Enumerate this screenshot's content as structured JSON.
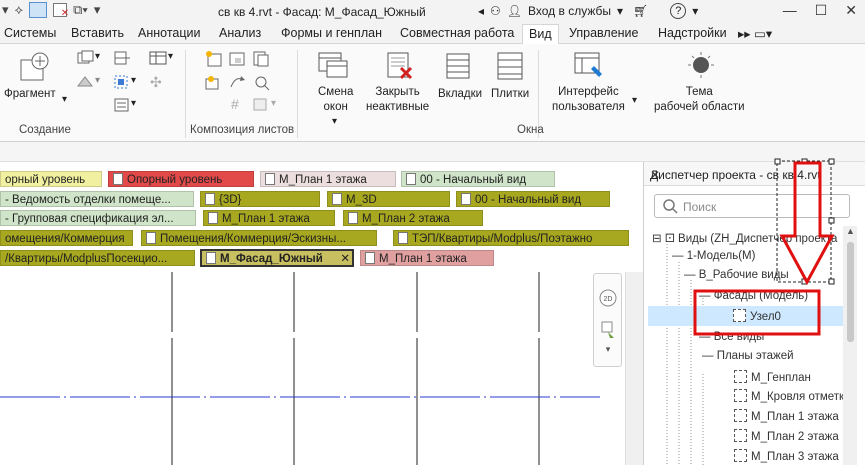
{
  "titlebar": {
    "title": "св кв 4.rvt - Фасад: М_Фасад_Южный",
    "signin": "Вход в службы",
    "signin_caret": "▾",
    "help": "?",
    "min": "—",
    "max": "☐",
    "close": "✕"
  },
  "tabs": [
    "Системы",
    "Вставить",
    "Аннотации",
    "Анализ",
    "Формы и генплан",
    "Совместная работа",
    "Вид",
    "Управление",
    "Надстройки"
  ],
  "ribbon": {
    "fragment": "Фрагмент",
    "create_panel": "Создание",
    "sheet_panel": "Композиция листов",
    "switch_windows": "Смена\nокон",
    "close_inactive": "Закрыть\nнеактивные",
    "tab_views": "Вкладки",
    "tiles": "Плитки",
    "ui": "Интерфейс\nпользователя",
    "theme": "Тема\nрабочей области",
    "windows_panel": "Окна"
  },
  "viewtabs": [
    {
      "label": "орный уровень",
      "color": "#f0f0a0"
    },
    {
      "label": "Опорный уровень",
      "color": "#e24a4a"
    },
    {
      "label": "М_План 1 этажа",
      "color": "#e8d8d8"
    },
    {
      "label": "00 - Начальный вид",
      "color": "#c8e0c0"
    },
    {
      "label": "- Ведомость отделки помеще...",
      "color": "#c8e0c0"
    },
    {
      "label": "{3D}",
      "color": "#a8a820"
    },
    {
      "label": "М_3D",
      "color": "#a8a820"
    },
    {
      "label": "00 - Начальный вид",
      "color": "#a8a820"
    },
    {
      "label": "- Групповая спецификация эл...",
      "color": "#c8e0c0"
    },
    {
      "label": "М_План 1 этажа",
      "color": "#a8a820"
    },
    {
      "label": "М_План 2 этажа",
      "color": "#a8a820"
    },
    {
      "label": "омещения/Коммерция",
      "color": "#a8a820"
    },
    {
      "label": "Помещения/Коммерция/Эскизны...",
      "color": "#a8a820"
    },
    {
      "label": "ТЭП/Квартиры/Modplus/Поэтажно",
      "color": "#a8a820"
    },
    {
      "label": "/Квартиры/ModplusПосекцио...",
      "color": "#a8a820"
    },
    {
      "label": "М_Фасад_Южный",
      "color": "#c8c060"
    },
    {
      "label": "М_План 1 этажа",
      "color": "#e0a0a0"
    }
  ],
  "browser": {
    "title": "Диспетчер проекта - св кв 4.rvt",
    "search_placeholder": "Поиск",
    "rows": [
      "Виды (ZH_Диспетчер проекта",
      "1-Модель(М)",
      "В_Рабочие виды",
      "Фасады (Модель)",
      "Узел0",
      "Все виды",
      "Планы этажей",
      "М_Генплан",
      "М_Кровля отметка",
      "М_План 1 этажа",
      "М_План 2 этажа",
      "М_План 3 этажа"
    ]
  },
  "colors": {
    "highlight_red": "#e01010",
    "selection_blue": "#cde8ff",
    "grid_blue": "#2a3ad6"
  }
}
